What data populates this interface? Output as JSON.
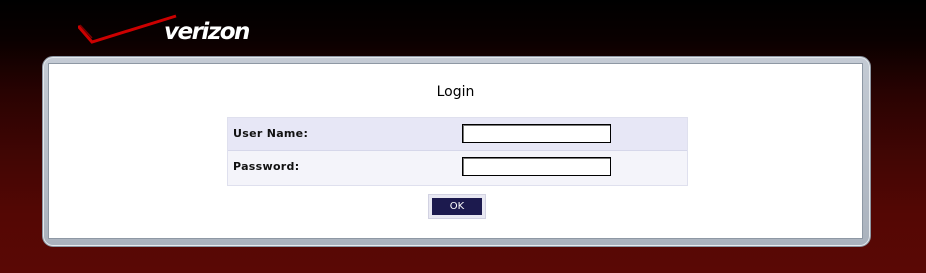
{
  "brand": {
    "logo_text": "verizon",
    "logo_icon": "verizon-checkmark-logo",
    "accent_color": "#cc0000"
  },
  "login": {
    "title": "Login",
    "username_label": "User Name:",
    "username_value": "",
    "password_label": "Password:",
    "password_value": "",
    "ok_label": "OK"
  },
  "colors": {
    "background_top": "#000000",
    "background_bottom": "#5a0805",
    "username_row": "#e7e7f6",
    "password_row": "#f4f4fa",
    "button": "#1c1a4e"
  }
}
